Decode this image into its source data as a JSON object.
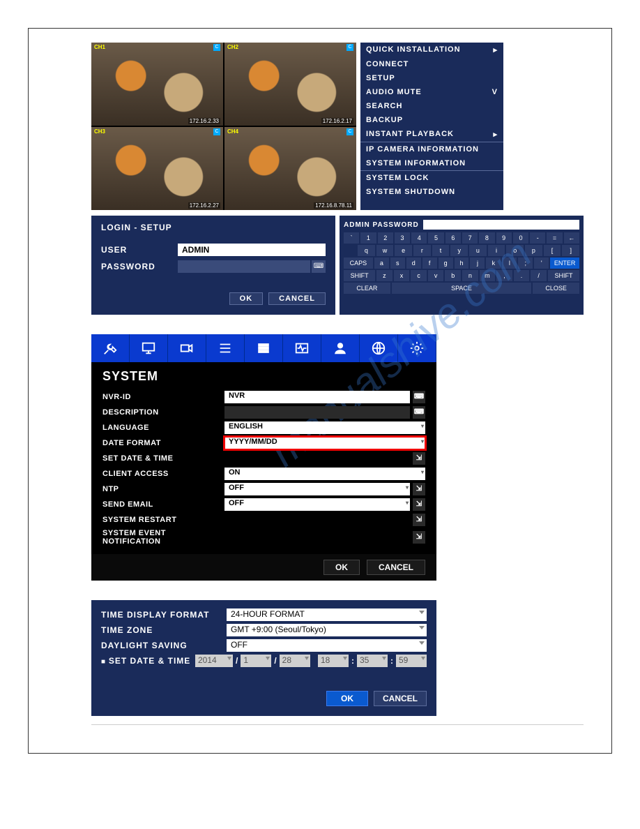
{
  "cameras": [
    {
      "ch": "CH1",
      "ip": "172.16.2.33"
    },
    {
      "ch": "CH2",
      "ip": "172.16.2.17"
    },
    {
      "ch": "CH3",
      "ip": "172.16.2.27"
    },
    {
      "ch": "CH4",
      "ip": "172.16.8.78.11"
    }
  ],
  "context_menu": {
    "items": [
      "QUICK INSTALLATION",
      "CONNECT",
      "SETUP",
      "AUDIO MUTE",
      "SEARCH",
      "BACKUP",
      "INSTANT PLAYBACK",
      "IP CAMERA INFORMATION",
      "SYSTEM INFORMATION",
      "SYSTEM LOCK",
      "SYSTEM SHUTDOWN"
    ],
    "audio_mute_indicator": "V"
  },
  "login": {
    "title": "LOGIN - SETUP",
    "user_label": "USER",
    "user_value": "ADMIN",
    "password_label": "PASSWORD",
    "password_value": "",
    "ok": "OK",
    "cancel": "CANCEL"
  },
  "keyboard": {
    "title": "ADMIN PASSWORD",
    "row1": [
      "`",
      "1",
      "2",
      "3",
      "4",
      "5",
      "6",
      "7",
      "8",
      "9",
      "0",
      "-",
      "=",
      "←"
    ],
    "row2": [
      "q",
      "w",
      "e",
      "r",
      "t",
      "y",
      "u",
      "i",
      "o",
      "p",
      "[",
      "]"
    ],
    "row3_caps": "CAPS",
    "row3": [
      "a",
      "s",
      "d",
      "f",
      "g",
      "h",
      "j",
      "k",
      "l",
      ";",
      "'"
    ],
    "row3_enter": "ENTER",
    "row4_shift_l": "SHIFT",
    "row4": [
      "z",
      "x",
      "c",
      "v",
      "b",
      "n",
      "m",
      ",",
      ".",
      "/"
    ],
    "row4_shift_r": "SHIFT",
    "row5_clear": "CLEAR",
    "row5_space": "SPACE",
    "row5_close": "CLOSE"
  },
  "system": {
    "heading": "SYSTEM",
    "rows": [
      {
        "label": "NVR-ID",
        "value": "NVR",
        "kb": true
      },
      {
        "label": "DESCRIPTION",
        "value": "",
        "kb": true,
        "dark": true
      },
      {
        "label": "LANGUAGE",
        "value": "ENGLISH",
        "dd": true
      },
      {
        "label": "DATE FORMAT",
        "value": "YYYY/MM/DD",
        "dd": true,
        "highlight": true
      },
      {
        "label": "SET DATE & TIME",
        "value": "",
        "sub": true
      },
      {
        "label": "CLIENT ACCESS",
        "value": "ON",
        "dd": true
      },
      {
        "label": "NTP",
        "value": "OFF",
        "dd": true,
        "sub": true
      },
      {
        "label": "SEND EMAIL",
        "value": "OFF",
        "dd": true,
        "sub": true
      },
      {
        "label": "SYSTEM RESTART",
        "value": "",
        "sub": true
      },
      {
        "label": "SYSTEM EVENT NOTIFICATION",
        "value": "",
        "sub": true
      }
    ],
    "ok": "OK",
    "cancel": "CANCEL"
  },
  "time": {
    "display_format_label": "TIME DISPLAY FORMAT",
    "display_format_value": "24-HOUR FORMAT",
    "zone_label": "TIME ZONE",
    "zone_value": "GMT +9:00 (Seoul/Tokyo)",
    "dst_label": "DAYLIGHT SAVING",
    "dst_value": "OFF",
    "set_label": "SET DATE & TIME",
    "year": "2014",
    "mon": "1",
    "day": "28",
    "hour": "18",
    "min": "35",
    "sec": "59",
    "ok": "OK",
    "cancel": "CANCEL"
  }
}
